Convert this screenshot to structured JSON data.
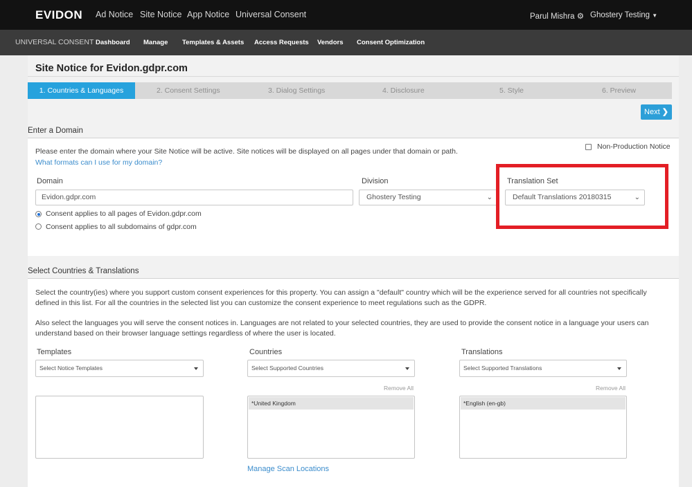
{
  "topbar": {
    "logo": "EVIDON",
    "nav": [
      "Ad Notice",
      "Site Notice",
      "App Notice",
      "Universal Consent"
    ],
    "user_name": "Parul Mishra",
    "account": "Ghostery Testing"
  },
  "subbar": {
    "section": "UNIVERSAL CONSENT",
    "items": [
      "Dashboard",
      "Manage",
      "Templates & Assets",
      "Access Requests",
      "Vendors",
      "Consent Optimization"
    ]
  },
  "page": {
    "title": "Site Notice for Evidon.gdpr.com",
    "steps": [
      "1. Countries & Languages",
      "2. Consent Settings",
      "3. Dialog Settings",
      "4. Disclosure",
      "5. Style",
      "6. Preview"
    ],
    "next_label": "Next"
  },
  "domain_section": {
    "heading": "Enter a Domain",
    "description": "Please enter the domain where your Site Notice will be active. Site notices will be displayed on all pages under that domain or path.",
    "help_link": "What formats can I use for my domain?",
    "non_production_label": "Non-Production Notice",
    "domain_label": "Domain",
    "domain_value": "Evidon.gdpr.com",
    "division_label": "Division",
    "division_value": "Ghostery Testing",
    "translation_set_label": "Translation Set",
    "translation_set_value": "Default Translations 20180315",
    "radio_all_pages": "Consent applies to all pages of Evidon.gdpr.com",
    "radio_subdomains": "Consent applies to all subdomains of gdpr.com"
  },
  "countries_section": {
    "heading": "Select Countries & Translations",
    "para1_line1": "Select the country(ies) where you support custom consent experiences for this property. You can assign a \"default\" country which will be the experience served for all countries not specifically",
    "para1_line2": "defined in this list. For all the countries in the selected list you can customize the consent experience to meet regulations such as the GDPR.",
    "para2_line1": "Also select the languages you will serve the consent notices in. Languages are not related to your selected countries, they are used to provide the consent notice in a language your users can",
    "para2_line2": "understand based on their browser language settings regardless of where the user is located.",
    "templates_label": "Templates",
    "templates_placeholder": "Select Notice Templates",
    "countries_label": "Countries",
    "countries_placeholder": "Select Supported Countries",
    "translations_label": "Translations",
    "translations_placeholder": "Select Supported Translations",
    "remove_all": "Remove All",
    "selected_country": "*United Kingdom",
    "selected_translation": "*English (en-gb)",
    "manage_scan_link": "Manage Scan Locations"
  }
}
